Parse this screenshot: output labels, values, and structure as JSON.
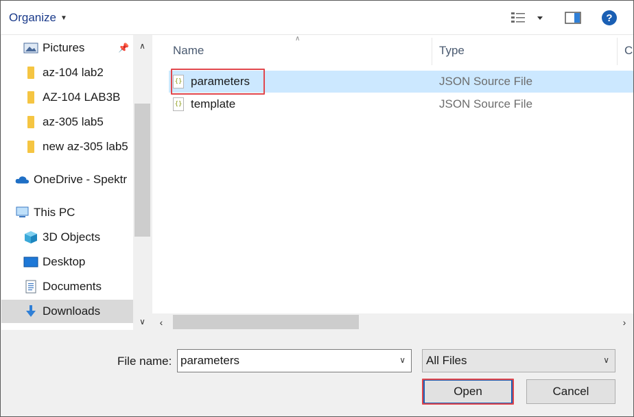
{
  "toolbar": {
    "organize_label": "Organize",
    "help_label": "?"
  },
  "nav": {
    "items": [
      {
        "label": "Pictures",
        "icon": "pictures-icon"
      },
      {
        "label": "az-104 lab2",
        "icon": "folder-icon"
      },
      {
        "label": "AZ-104 LAB3B",
        "icon": "folder-icon"
      },
      {
        "label": "az-305 lab5",
        "icon": "folder-icon"
      },
      {
        "label": "new az-305 lab5",
        "icon": "folder-icon"
      },
      {
        "label": "OneDrive - Spektr",
        "icon": "onedrive-icon"
      },
      {
        "label": "This PC",
        "icon": "this-pc-icon"
      },
      {
        "label": "3D Objects",
        "icon": "3d-objects-icon"
      },
      {
        "label": "Desktop",
        "icon": "desktop-icon"
      },
      {
        "label": "Documents",
        "icon": "documents-icon"
      },
      {
        "label": "Downloads",
        "icon": "downloads-icon"
      }
    ]
  },
  "file_list": {
    "columns": {
      "name": "Name",
      "type": "Type",
      "third": "Co"
    },
    "rows": [
      {
        "name": "parameters",
        "type": "JSON Source File",
        "selected": true
      },
      {
        "name": "template",
        "type": "JSON Source File",
        "selected": false
      }
    ],
    "file_icon_glyph": "{}"
  },
  "bottom": {
    "filename_label": "File name:",
    "filename_value": "parameters",
    "filter_value": "All Files",
    "open_label": "Open",
    "cancel_label": "Cancel"
  },
  "colors": {
    "accent": "#1a5fb4",
    "selection": "#cce8ff",
    "highlight": "#e0464c",
    "folder": "#f5c542"
  }
}
